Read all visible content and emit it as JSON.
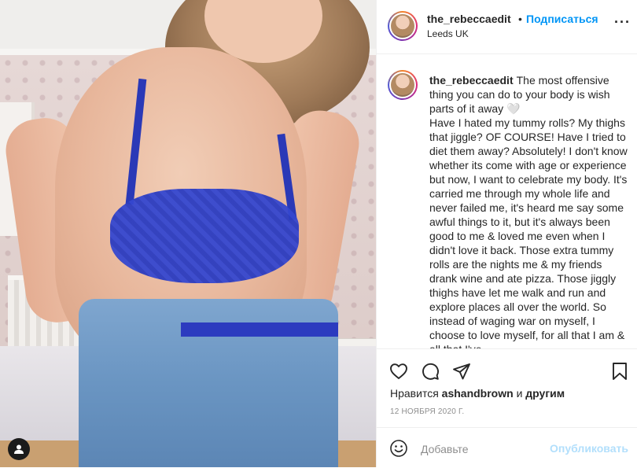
{
  "post": {
    "username": "the_rebeccaedit",
    "separator": "•",
    "follow_label": "Подписаться",
    "location": "Leeds UK",
    "more_label": "···"
  },
  "caption": {
    "username": "the_rebeccaedit",
    "text_first": "The most offensive thing you can do to your body is wish parts of it away",
    "heart": "🤍",
    "text_body": "Have I hated my tummy rolls? My thighs that jiggle? OF COURSE! Have I tried to diet them away? Absolutely! I don't know whether its come with age or experience but now, I want to celebrate my body. It's carried me through my whole life and never failed me, it's heard me say some awful things to it, but it's always been good to me & loved me even when I didn't love it back. Those extra tummy rolls are the nights me & my friends drank wine and ate pizza. Those jiggly thighs have let me walk and run and explore places all over the world. So instead of waging war on myself, I choose to love myself, for all that I am & all that I've"
  },
  "likes": {
    "prefix": "Нравится",
    "user": "ashandbrown",
    "conj": "и",
    "others": "другим"
  },
  "date": "12 НОЯБРЯ 2020 Г.",
  "comment_box": {
    "placeholder": "Добавьте",
    "publish_label": "Опубликовать"
  },
  "icons": {
    "like": "heart-icon",
    "comment": "comment-icon",
    "share": "share-icon",
    "save": "bookmark-icon",
    "emoji": "emoji-icon",
    "user_tag": "user-tag-icon"
  },
  "colors": {
    "link": "#0095f6",
    "publish_disabled": "#b2dffc",
    "muted": "#8e8e8e",
    "text": "#262626",
    "bra_blue": "#2b3cc0"
  }
}
